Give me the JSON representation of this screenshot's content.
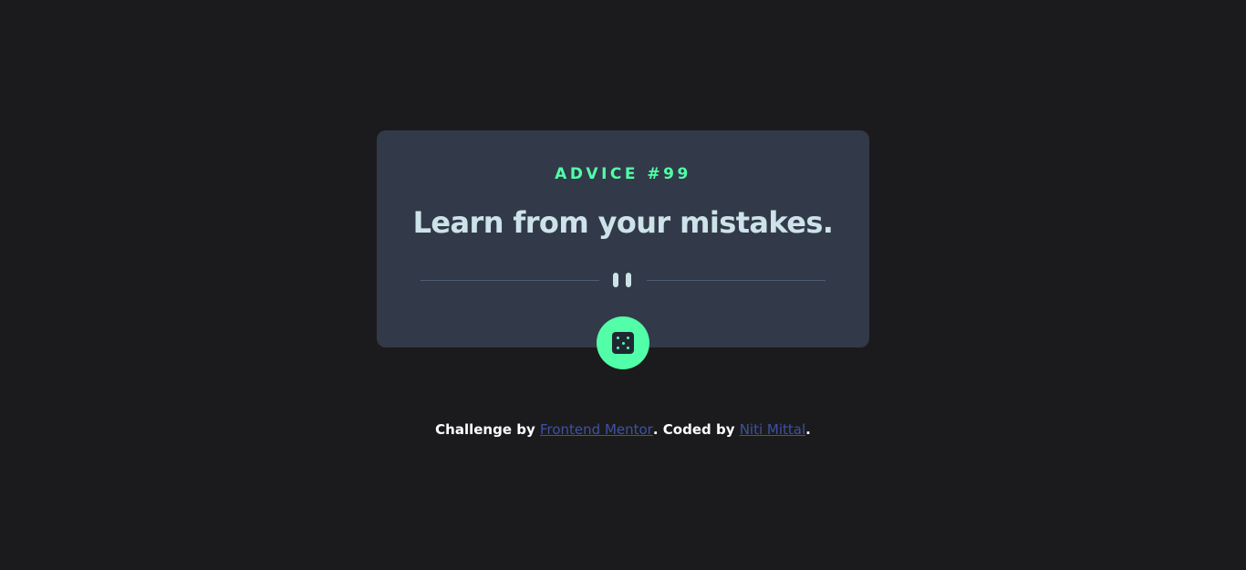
{
  "card": {
    "advice_id": "ADVICE #99",
    "advice_text": "Learn from your mistakes."
  },
  "icons": {
    "divider": "pause-icon",
    "button": "dice-icon"
  },
  "footer": {
    "prefix": "Challenge by ",
    "link1": "Frontend Mentor",
    "middle": ". Coded by ",
    "link2": "Niti Mittal",
    "suffix": "."
  },
  "colors": {
    "background": "#1b1b1d",
    "card": "#323a49",
    "accent": "#52ffa8",
    "text": "#cee3e9",
    "link": "#3e52a3"
  }
}
